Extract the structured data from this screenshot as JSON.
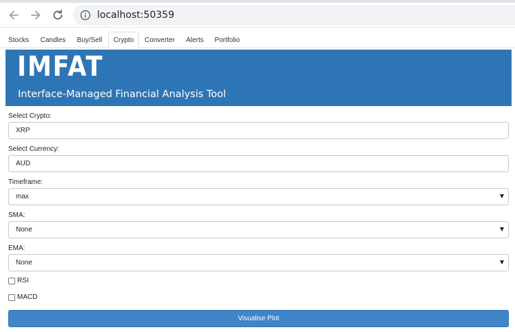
{
  "browser": {
    "url": "localhost:50359",
    "icons": [
      "back-arrow-icon",
      "forward-arrow-icon",
      "reload-icon",
      "info-icon"
    ]
  },
  "tabs": [
    {
      "label": "Stocks",
      "active": false
    },
    {
      "label": "Candles",
      "active": false
    },
    {
      "label": "Buy/Sell",
      "active": false
    },
    {
      "label": "Crypto",
      "active": true
    },
    {
      "label": "Converter",
      "active": false
    },
    {
      "label": "Alerts",
      "active": false
    },
    {
      "label": "Portfolio",
      "active": false
    }
  ],
  "banner": {
    "title": "IMFAT",
    "subtitle": "Interface-Managed Financial Analysis Tool",
    "background": "#2e75b6"
  },
  "form": {
    "crypto_label": "Select Crypto:",
    "crypto_value": "XRP",
    "currency_label": "Select Currency:",
    "currency_value": "AUD",
    "timeframe_label": "Timeframe:",
    "timeframe_value": "max",
    "sma_label": "SMA:",
    "sma_value": "None",
    "ema_label": "EMA:",
    "ema_value": "None",
    "rsi_label": "RSI",
    "rsi_checked": false,
    "macd_label": "MACD",
    "macd_checked": false,
    "submit_label": "Visualise Plot",
    "submit_color": "#3f85c8"
  }
}
